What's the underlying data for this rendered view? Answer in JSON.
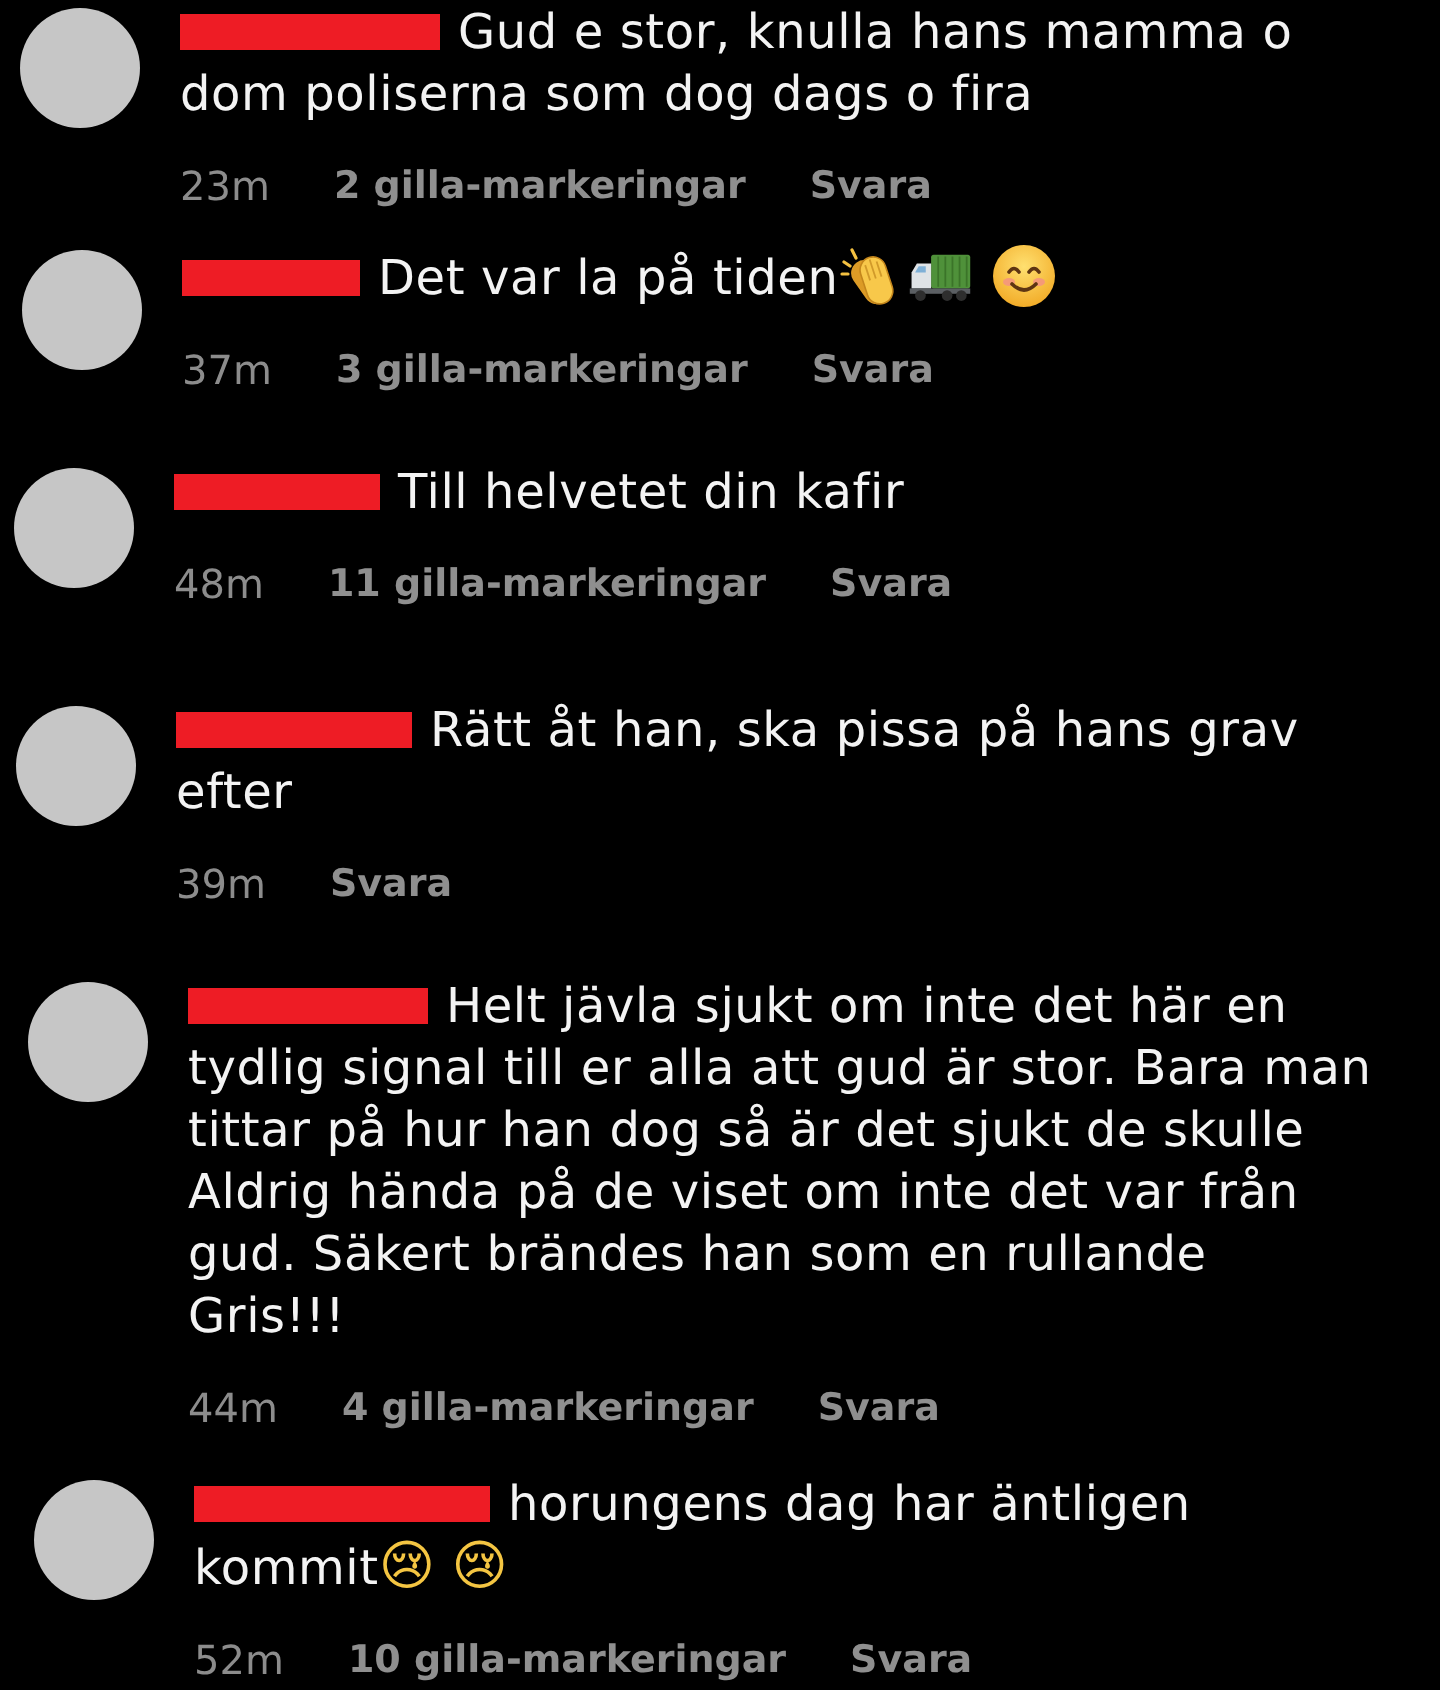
{
  "comments": [
    {
      "redacted": true,
      "text": "Gud e stor, knulla hans mamma o dom poliserna som dog dags o fira",
      "time": "23m",
      "likes": "2 gilla-markeringar",
      "reply": "Svara"
    },
    {
      "redacted": true,
      "text": "Det var la på tiden",
      "time": "37m",
      "likes": "3 gilla-markeringar",
      "reply": "Svara"
    },
    {
      "redacted": true,
      "text": "Till helvetet din kafir",
      "time": "48m",
      "likes": "11 gilla-markeringar",
      "reply": "Svara"
    },
    {
      "redacted": true,
      "text": "Rätt åt han, ska pissa på hans grav efter",
      "time": "39m",
      "reply": "Svara"
    },
    {
      "redacted": true,
      "text": "Helt jävla sjukt om inte det här en tydlig signal till er alla att gud är stor. Bara man tittar på hur han dog så är det sjukt de skulle Aldrig hända på de viset om inte det var från gud. Säkert brändes han som en rullande Gris!!!",
      "time": "44m",
      "likes": "4 gilla-markeringar",
      "reply": "Svara"
    },
    {
      "redacted": true,
      "text": "horungens dag har äntligen kommit😢 😢",
      "time": "52m",
      "likes": "10 gilla-markeringar",
      "reply": "Svara"
    }
  ]
}
